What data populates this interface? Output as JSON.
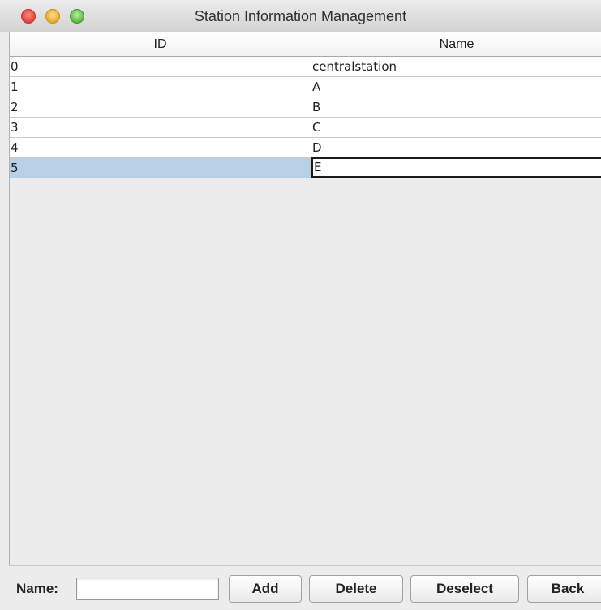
{
  "window": {
    "title": "Station Information Management"
  },
  "table": {
    "columns": [
      "ID",
      "Name"
    ],
    "rows": [
      {
        "id": "0",
        "name": "centralstation"
      },
      {
        "id": "1",
        "name": "A"
      },
      {
        "id": "2",
        "name": "B"
      },
      {
        "id": "3",
        "name": "C"
      },
      {
        "id": "4",
        "name": "D"
      },
      {
        "id": "5",
        "name": "E"
      }
    ],
    "selected_row": 5
  },
  "form": {
    "name_label": "Name:",
    "name_value": "",
    "add_label": "Add",
    "delete_label": "Delete",
    "deselect_label": "Deselect",
    "back_label": "Back"
  },
  "colors": {
    "selection": "#b8cfe5",
    "close": "#e0443e",
    "minimize": "#e8a82a",
    "zoom": "#5cb845"
  }
}
